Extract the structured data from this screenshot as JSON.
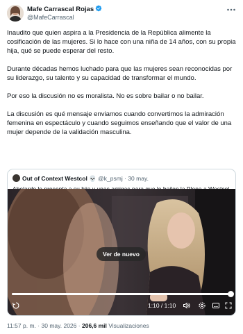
{
  "author": {
    "name": "Mafe Carrascal Rojas",
    "handle": "@MafeCarrascal",
    "verified": true
  },
  "tweet": {
    "paragraphs": [
      "Inaudito que quien aspira a la Presidencia de la República alimente la cosificación de las mujeres. Si lo hace con una niña de 14 años, con su propia hija, qué se puede esperar del resto.",
      "Durante décadas hemos luchado para que las mujeres sean reconocidas por su liderazgo, su talento y su capacidad de transformar el mundo.",
      "Por eso la discusión no es moralista. No es sobre bailar o no bailar.",
      "La discusión es qué mensaje enviamos cuando convertimos la admiración femenina en espectáculo y cuando seguimos enseñando que el valor de una mujer depende de la validación masculina."
    ]
  },
  "quote": {
    "name": "Out of Context Westcol",
    "name_emoji": "💀",
    "handle": "@k_psmj",
    "separator": "·",
    "date": "30 may.",
    "text": "Abelardo le presenta a su hija y unas amigas para que le bailen la Plena a Westcol 😭",
    "video": {
      "replay_label": "Ver de nuevo",
      "time": "1:10 / 1:10",
      "progress": 1.0
    }
  },
  "footer": {
    "time": "11:57 p. m.",
    "separator": "·",
    "date": "30 may. 2026",
    "views": "206,6 mil",
    "views_label": "Visualizaciones"
  },
  "colors": {
    "verified": "#1d9bf0",
    "secondary_text": "#536471",
    "border": "#cfd9de"
  },
  "icons": [
    "more-icon",
    "verified-badge-icon",
    "skull-icon",
    "play-icon",
    "volume-icon",
    "settings-icon",
    "fullscreen-icon",
    "captions-icon"
  ]
}
